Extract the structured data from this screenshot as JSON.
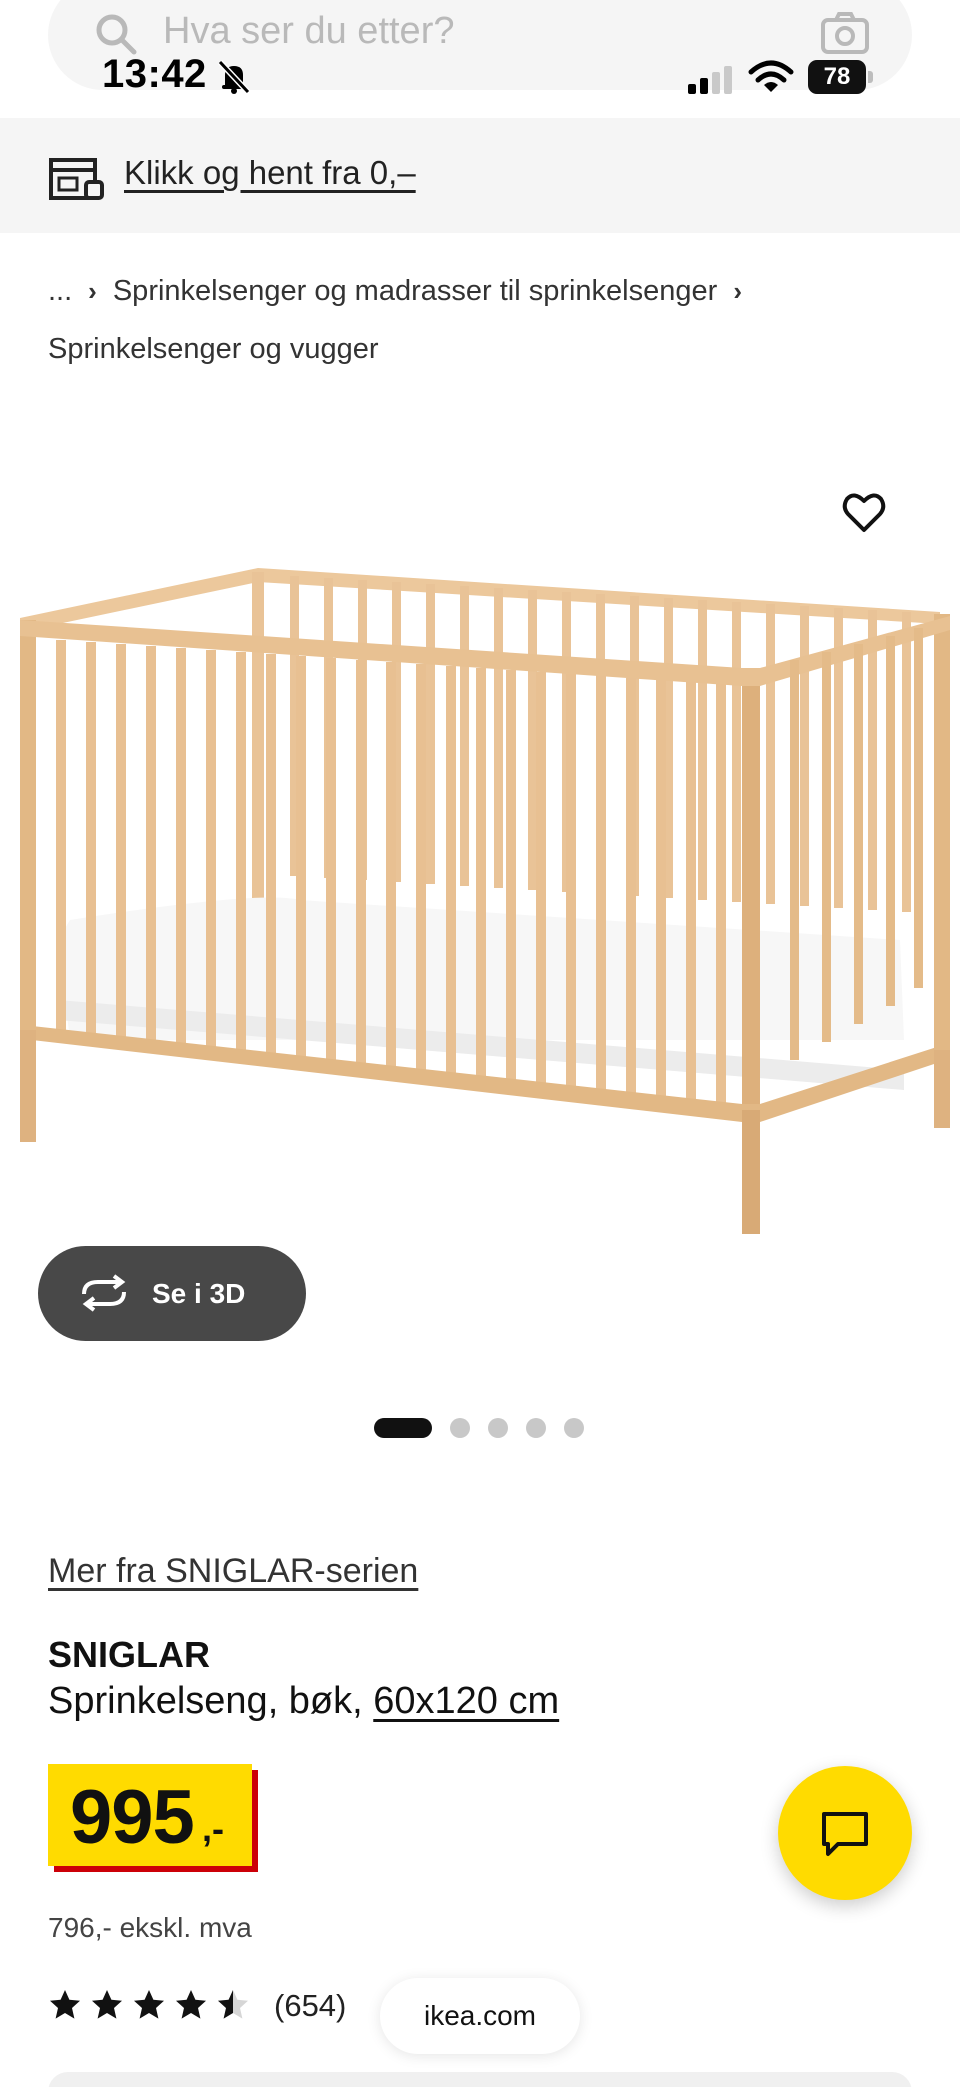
{
  "search": {
    "placeholder": "Hva ser du etter?"
  },
  "status_bar": {
    "time": "13:42",
    "battery": "78"
  },
  "banner": {
    "link": "Klikk og hent fra 0,–"
  },
  "breadcrumb": {
    "ellipsis": "...",
    "items": [
      "Sprinkelsenger og madrasser til sprinkelsenger",
      "Sprinkelsenger og vugger"
    ]
  },
  "gallery": {
    "view_3d_label": "Se i 3D",
    "image_count": 5,
    "active_index": 0
  },
  "product": {
    "series_link": "Mer fra SNIGLAR-serien",
    "name": "SNIGLAR",
    "description": "Sprinkelseng, bøk, ",
    "size": "60x120 cm",
    "price": "995",
    "price_suffix": ",-",
    "price_ex_vat": "796,- ekskl. mva",
    "rating": 4.5,
    "rating_count": "(654)"
  },
  "browser": {
    "url": "ikea.com"
  },
  "colors": {
    "accent_yellow": "#ffdb00",
    "price_red": "#cc0008",
    "wood": "#e9c397"
  }
}
